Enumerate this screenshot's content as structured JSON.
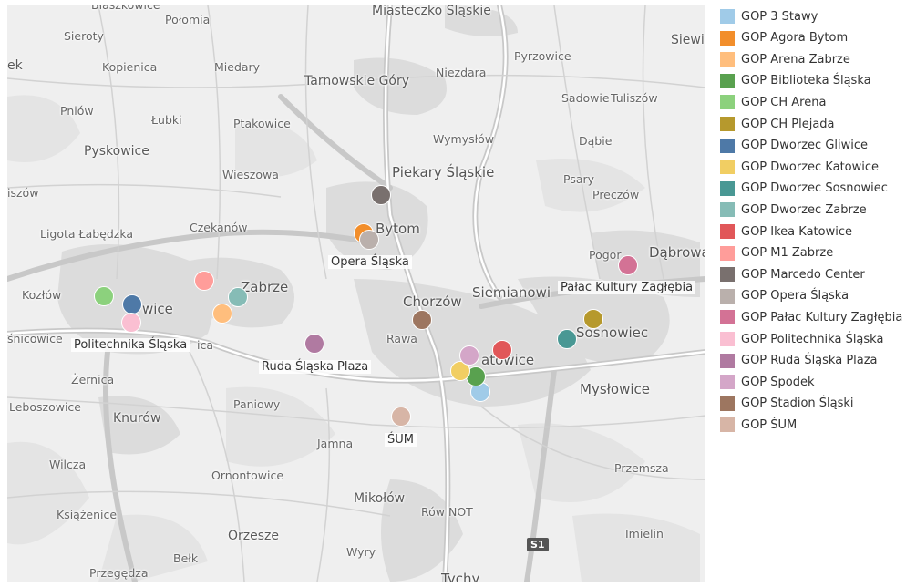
{
  "map": {
    "places": [
      {
        "id": "blaszkowice",
        "text": "Błaszkowice",
        "cls": ""
      },
      {
        "id": "polomia",
        "text": "Połomia",
        "cls": ""
      },
      {
        "id": "miasteczko",
        "text": "Miasteczko Śląskie",
        "cls": "med"
      },
      {
        "id": "siewi",
        "text": "Siewi",
        "cls": "med"
      },
      {
        "id": "sieroty",
        "text": "Sieroty",
        "cls": ""
      },
      {
        "id": "ek",
        "text": "ek",
        "cls": "med"
      },
      {
        "id": "kopienica",
        "text": "Kopienica",
        "cls": ""
      },
      {
        "id": "miedary",
        "text": "Miedary",
        "cls": ""
      },
      {
        "id": "niezdara",
        "text": "Niezdara",
        "cls": ""
      },
      {
        "id": "pyrzowice",
        "text": "Pyrzowice",
        "cls": ""
      },
      {
        "id": "tarnowskie",
        "text": "Tarnowskie Góry",
        "cls": "med"
      },
      {
        "id": "sadowie",
        "text": "Sadowie",
        "cls": ""
      },
      {
        "id": "tuliszow",
        "text": "Tuliszów",
        "cls": ""
      },
      {
        "id": "pniow",
        "text": "Pniów",
        "cls": ""
      },
      {
        "id": "lubki",
        "text": "Łubki",
        "cls": ""
      },
      {
        "id": "ptakowice",
        "text": "Ptakowice",
        "cls": ""
      },
      {
        "id": "wymyslow",
        "text": "Wymysłów",
        "cls": ""
      },
      {
        "id": "dabie",
        "text": "Dąbie",
        "cls": ""
      },
      {
        "id": "pyskowice",
        "text": "Pyskowice",
        "cls": "med"
      },
      {
        "id": "wieszowa",
        "text": "Wieszowa",
        "cls": ""
      },
      {
        "id": "piekary",
        "text": "Piekary Śląskie",
        "cls": "big"
      },
      {
        "id": "psary",
        "text": "Psary",
        "cls": ""
      },
      {
        "id": "iszow",
        "text": "iszów",
        "cls": ""
      },
      {
        "id": "preczow",
        "text": "Preczów",
        "cls": ""
      },
      {
        "id": "czekanow",
        "text": "Czekanów",
        "cls": ""
      },
      {
        "id": "bytom",
        "text": "Bytom",
        "cls": "big"
      },
      {
        "id": "ligota",
        "text": "Ligota Łabędzka",
        "cls": ""
      },
      {
        "id": "pogor",
        "text": "Pogor",
        "cls": ""
      },
      {
        "id": "dabrowa",
        "text": "Dąbrowa",
        "cls": "big"
      },
      {
        "id": "zabrze",
        "text": "Zabrze",
        "cls": "big"
      },
      {
        "id": "kozlow",
        "text": "Kozłów",
        "cls": ""
      },
      {
        "id": "siemianowi",
        "text": "Siemianowi",
        "cls": "big"
      },
      {
        "id": "wice",
        "text": "wice",
        "cls": "big"
      },
      {
        "id": "chorzow",
        "text": "Chorzów",
        "cls": "big"
      },
      {
        "id": "snicowice",
        "text": "śnicowice",
        "cls": ""
      },
      {
        "id": "ica",
        "text": "ica",
        "cls": ""
      },
      {
        "id": "rawa",
        "text": "Rawa",
        "cls": ""
      },
      {
        "id": "sosnowiec",
        "text": "Sosnowiec",
        "cls": "big"
      },
      {
        "id": "atowice",
        "text": "atowice",
        "cls": "big"
      },
      {
        "id": "zernica",
        "text": "Żernica",
        "cls": ""
      },
      {
        "id": "myslowice",
        "text": "Mysłowice",
        "cls": "big"
      },
      {
        "id": "leboszowice",
        "text": "Leboszowice",
        "cls": ""
      },
      {
        "id": "paniowy",
        "text": "Paniowy",
        "cls": ""
      },
      {
        "id": "knurow",
        "text": "Knurów",
        "cls": "med"
      },
      {
        "id": "jamna",
        "text": "Jamna",
        "cls": ""
      },
      {
        "id": "wilcza",
        "text": "Wilcza",
        "cls": ""
      },
      {
        "id": "przemsza",
        "text": "Przemsza",
        "cls": ""
      },
      {
        "id": "ornontowice",
        "text": "Ornontowice",
        "cls": ""
      },
      {
        "id": "mikolow",
        "text": "Mikołów",
        "cls": "med"
      },
      {
        "id": "ksiazenice",
        "text": "Książenice",
        "cls": ""
      },
      {
        "id": "rownot",
        "text": "Rów NOT",
        "cls": ""
      },
      {
        "id": "orzesze",
        "text": "Orzesze",
        "cls": "med"
      },
      {
        "id": "imielin",
        "text": "Imielin",
        "cls": ""
      },
      {
        "id": "wyry",
        "text": "Wyry",
        "cls": ""
      },
      {
        "id": "belk",
        "text": "Bełk",
        "cls": ""
      },
      {
        "id": "przegedza",
        "text": "Przegędza",
        "cls": ""
      },
      {
        "id": "tychy",
        "text": "Tychy",
        "cls": "big"
      }
    ],
    "road_shield": "S1",
    "marker_labels": [
      {
        "id": "opera",
        "text": "Opera Śląska"
      },
      {
        "id": "palac",
        "text": "Pałac Kultury Zagłębia"
      },
      {
        "id": "polit",
        "text": "Politechnika Śląska"
      },
      {
        "id": "ruda",
        "text": "Ruda Śląska Plaza"
      },
      {
        "id": "sum",
        "text": "ŚUM"
      }
    ]
  },
  "legend": {
    "items": [
      {
        "name": "GOP 3 Stawy",
        "color": "#a0cbe8"
      },
      {
        "name": "GOP Agora Bytom",
        "color": "#f28e2b"
      },
      {
        "name": "GOP Arena Zabrze",
        "color": "#ffbe7d"
      },
      {
        "name": "GOP Biblioteka Śląska",
        "color": "#59a14f"
      },
      {
        "name": "GOP CH Arena",
        "color": "#8cd17d"
      },
      {
        "name": "GOP CH Plejada",
        "color": "#b6992d"
      },
      {
        "name": "GOP Dworzec Gliwice",
        "color": "#4e79a7"
      },
      {
        "name": "GOP Dworzec Katowice",
        "color": "#f1ce63"
      },
      {
        "name": "GOP Dworzec Sosnowiec",
        "color": "#499894"
      },
      {
        "name": "GOP Dworzec Zabrze",
        "color": "#86bcb6"
      },
      {
        "name": "GOP Ikea Katowice",
        "color": "#e15759"
      },
      {
        "name": "GOP M1 Zabrze",
        "color": "#ff9d9a"
      },
      {
        "name": "GOP Marcedo Center",
        "color": "#79706e"
      },
      {
        "name": "GOP Opera Śląska",
        "color": "#bab0ac"
      },
      {
        "name": "GOP Pałac Kultury Zagłębia",
        "color": "#d37295"
      },
      {
        "name": "GOP Politechnika Śląska",
        "color": "#fabfd2"
      },
      {
        "name": "GOP Ruda Śląska Plaza",
        "color": "#b07aa1"
      },
      {
        "name": "GOP Spodek",
        "color": "#d4a6c8"
      },
      {
        "name": "GOP Stadion Śląski",
        "color": "#9d7660"
      },
      {
        "name": "GOP ŚUM",
        "color": "#d7b5a6"
      }
    ]
  }
}
